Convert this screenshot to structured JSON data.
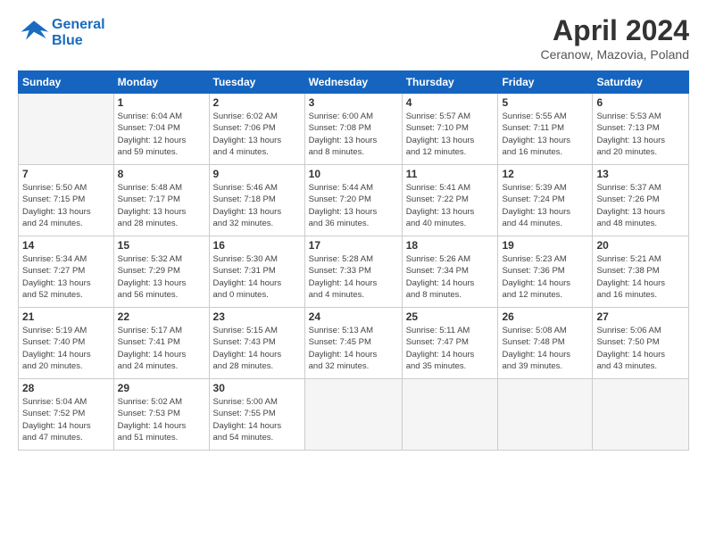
{
  "header": {
    "logo_general": "General",
    "logo_blue": "Blue",
    "month_title": "April 2024",
    "subtitle": "Ceranow, Mazovia, Poland"
  },
  "weekdays": [
    "Sunday",
    "Monday",
    "Tuesday",
    "Wednesday",
    "Thursday",
    "Friday",
    "Saturday"
  ],
  "days": [
    {
      "num": "",
      "info": ""
    },
    {
      "num": "1",
      "info": "Sunrise: 6:04 AM\nSunset: 7:04 PM\nDaylight: 12 hours\nand 59 minutes."
    },
    {
      "num": "2",
      "info": "Sunrise: 6:02 AM\nSunset: 7:06 PM\nDaylight: 13 hours\nand 4 minutes."
    },
    {
      "num": "3",
      "info": "Sunrise: 6:00 AM\nSunset: 7:08 PM\nDaylight: 13 hours\nand 8 minutes."
    },
    {
      "num": "4",
      "info": "Sunrise: 5:57 AM\nSunset: 7:10 PM\nDaylight: 13 hours\nand 12 minutes."
    },
    {
      "num": "5",
      "info": "Sunrise: 5:55 AM\nSunset: 7:11 PM\nDaylight: 13 hours\nand 16 minutes."
    },
    {
      "num": "6",
      "info": "Sunrise: 5:53 AM\nSunset: 7:13 PM\nDaylight: 13 hours\nand 20 minutes."
    },
    {
      "num": "7",
      "info": "Sunrise: 5:50 AM\nSunset: 7:15 PM\nDaylight: 13 hours\nand 24 minutes."
    },
    {
      "num": "8",
      "info": "Sunrise: 5:48 AM\nSunset: 7:17 PM\nDaylight: 13 hours\nand 28 minutes."
    },
    {
      "num": "9",
      "info": "Sunrise: 5:46 AM\nSunset: 7:18 PM\nDaylight: 13 hours\nand 32 minutes."
    },
    {
      "num": "10",
      "info": "Sunrise: 5:44 AM\nSunset: 7:20 PM\nDaylight: 13 hours\nand 36 minutes."
    },
    {
      "num": "11",
      "info": "Sunrise: 5:41 AM\nSunset: 7:22 PM\nDaylight: 13 hours\nand 40 minutes."
    },
    {
      "num": "12",
      "info": "Sunrise: 5:39 AM\nSunset: 7:24 PM\nDaylight: 13 hours\nand 44 minutes."
    },
    {
      "num": "13",
      "info": "Sunrise: 5:37 AM\nSunset: 7:26 PM\nDaylight: 13 hours\nand 48 minutes."
    },
    {
      "num": "14",
      "info": "Sunrise: 5:34 AM\nSunset: 7:27 PM\nDaylight: 13 hours\nand 52 minutes."
    },
    {
      "num": "15",
      "info": "Sunrise: 5:32 AM\nSunset: 7:29 PM\nDaylight: 13 hours\nand 56 minutes."
    },
    {
      "num": "16",
      "info": "Sunrise: 5:30 AM\nSunset: 7:31 PM\nDaylight: 14 hours\nand 0 minutes."
    },
    {
      "num": "17",
      "info": "Sunrise: 5:28 AM\nSunset: 7:33 PM\nDaylight: 14 hours\nand 4 minutes."
    },
    {
      "num": "18",
      "info": "Sunrise: 5:26 AM\nSunset: 7:34 PM\nDaylight: 14 hours\nand 8 minutes."
    },
    {
      "num": "19",
      "info": "Sunrise: 5:23 AM\nSunset: 7:36 PM\nDaylight: 14 hours\nand 12 minutes."
    },
    {
      "num": "20",
      "info": "Sunrise: 5:21 AM\nSunset: 7:38 PM\nDaylight: 14 hours\nand 16 minutes."
    },
    {
      "num": "21",
      "info": "Sunrise: 5:19 AM\nSunset: 7:40 PM\nDaylight: 14 hours\nand 20 minutes."
    },
    {
      "num": "22",
      "info": "Sunrise: 5:17 AM\nSunset: 7:41 PM\nDaylight: 14 hours\nand 24 minutes."
    },
    {
      "num": "23",
      "info": "Sunrise: 5:15 AM\nSunset: 7:43 PM\nDaylight: 14 hours\nand 28 minutes."
    },
    {
      "num": "24",
      "info": "Sunrise: 5:13 AM\nSunset: 7:45 PM\nDaylight: 14 hours\nand 32 minutes."
    },
    {
      "num": "25",
      "info": "Sunrise: 5:11 AM\nSunset: 7:47 PM\nDaylight: 14 hours\nand 35 minutes."
    },
    {
      "num": "26",
      "info": "Sunrise: 5:08 AM\nSunset: 7:48 PM\nDaylight: 14 hours\nand 39 minutes."
    },
    {
      "num": "27",
      "info": "Sunrise: 5:06 AM\nSunset: 7:50 PM\nDaylight: 14 hours\nand 43 minutes."
    },
    {
      "num": "28",
      "info": "Sunrise: 5:04 AM\nSunset: 7:52 PM\nDaylight: 14 hours\nand 47 minutes."
    },
    {
      "num": "29",
      "info": "Sunrise: 5:02 AM\nSunset: 7:53 PM\nDaylight: 14 hours\nand 51 minutes."
    },
    {
      "num": "30",
      "info": "Sunrise: 5:00 AM\nSunset: 7:55 PM\nDaylight: 14 hours\nand 54 minutes."
    },
    {
      "num": "",
      "info": ""
    },
    {
      "num": "",
      "info": ""
    },
    {
      "num": "",
      "info": ""
    },
    {
      "num": "",
      "info": ""
    }
  ],
  "colors": {
    "header_bg": "#1565c0",
    "header_text": "#ffffff",
    "cell_border": "#cccccc",
    "empty_bg": "#f5f5f5"
  }
}
